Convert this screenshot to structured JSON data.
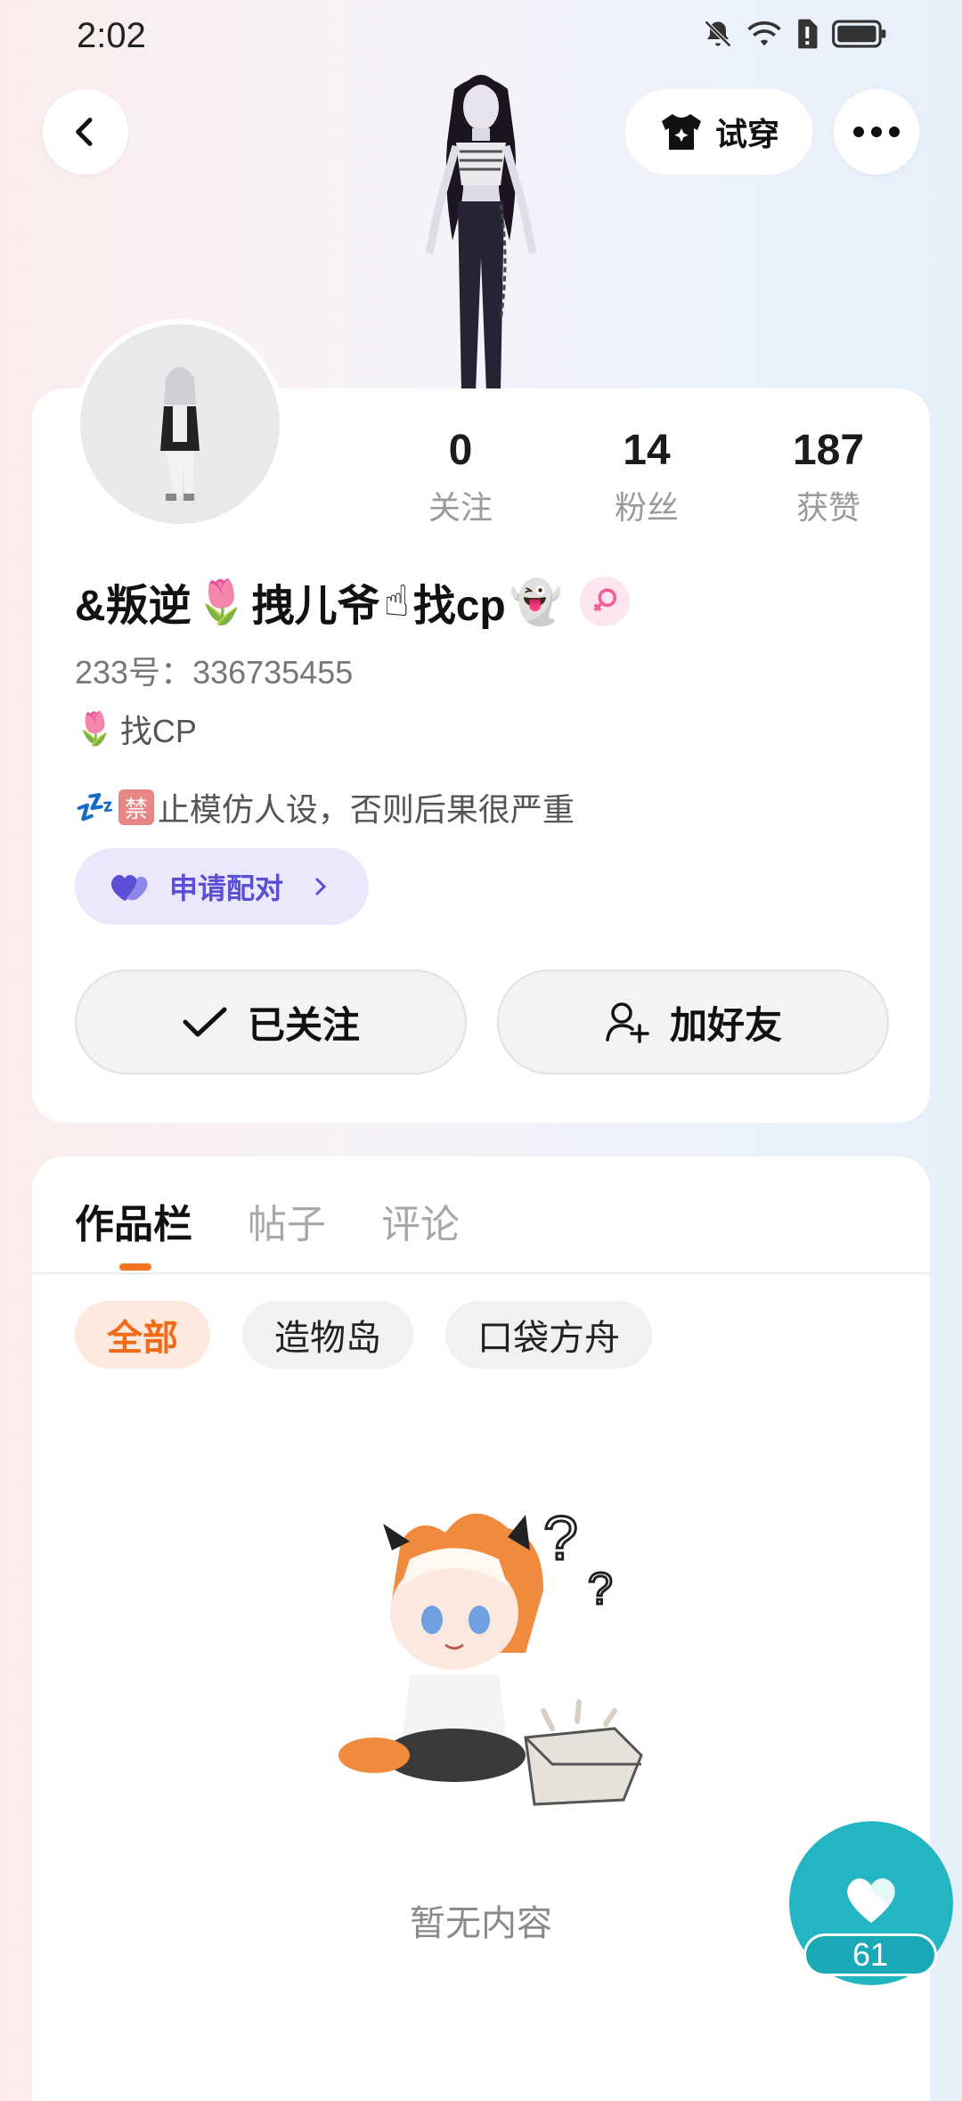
{
  "status_bar": {
    "time": "2:02"
  },
  "header": {
    "try_on_label": "试穿"
  },
  "profile": {
    "stats": [
      {
        "value": "0",
        "label": "关注"
      },
      {
        "value": "14",
        "label": "粉丝"
      },
      {
        "value": "187",
        "label": "获赞"
      }
    ],
    "name_parts": [
      "&叛逆",
      "🌷",
      "拽儿爷",
      "☝",
      "找cp",
      "👻"
    ],
    "uid": "233号：336735455",
    "tag_emoji": "🌷",
    "tag_text": "找CP",
    "bio_emoji": "💤",
    "bio_badge": "禁",
    "bio_text": "止模仿人设，否则后果很严重",
    "pair_label": "申请配对",
    "follow_label": "已关注",
    "add_friend_label": "加好友"
  },
  "works": {
    "tabs": [
      "作品栏",
      "帖子",
      "评论"
    ],
    "chips": [
      "全部",
      "造物岛",
      "口袋方舟"
    ],
    "empty_text": "暂无内容"
  },
  "like_fab": {
    "count": "61"
  },
  "colors": {
    "accent_orange": "#f37321",
    "pair_purple": "#5a4fd6",
    "like_teal": "#23b6c2"
  }
}
